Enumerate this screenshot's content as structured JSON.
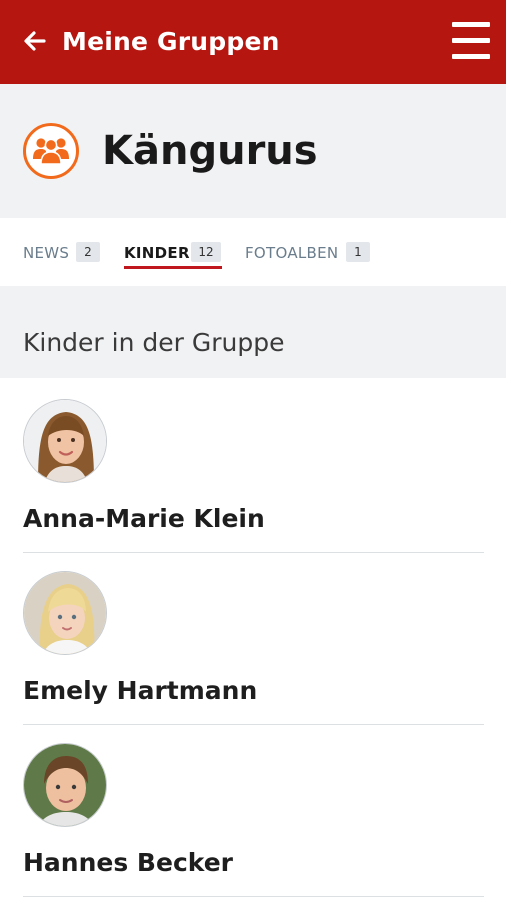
{
  "topbar": {
    "back_icon": "arrow-left-icon",
    "title": "Meine Gruppen",
    "menu_icon": "hamburger-menu-icon",
    "color": "#b5160f"
  },
  "group": {
    "icon": "group-people-icon",
    "icon_color": "#f26a1b",
    "name": "Kängurus"
  },
  "tabs": [
    {
      "label": "NEWS",
      "count": "2",
      "active": false
    },
    {
      "label": "KINDER",
      "count": "12",
      "active": true
    },
    {
      "label": "FOTOALBEN",
      "count": "1",
      "active": false
    }
  ],
  "section": {
    "title": "Kinder in der Gruppe"
  },
  "children": [
    {
      "name": "Anna-Marie Klein",
      "avatar": "child-photo"
    },
    {
      "name": "Emely Hartmann",
      "avatar": "child-photo"
    },
    {
      "name": "Hannes Becker",
      "avatar": "child-photo"
    }
  ]
}
